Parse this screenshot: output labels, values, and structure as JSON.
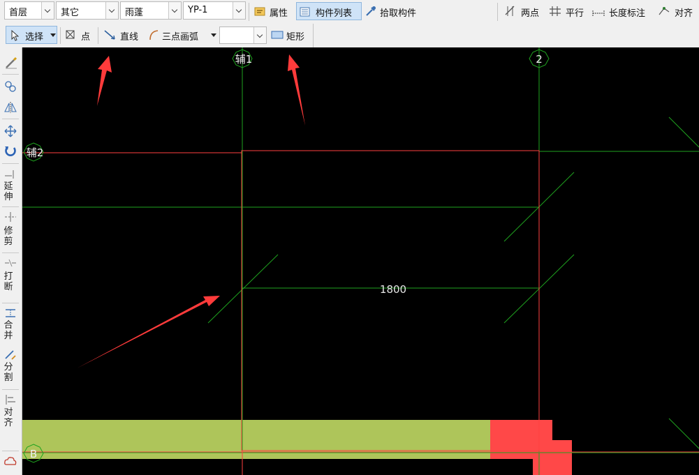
{
  "toolbar_top": {
    "floor_select": "首层",
    "type_select": "其它",
    "component_select": "雨蓬",
    "item_select": "YP-1",
    "properties_label": "属性",
    "component_list_label": "构件列表",
    "pick_component_label": "拾取构件",
    "two_points_label": "两点",
    "parallel_label": "平行",
    "length_dim_label": "长度标注",
    "align_label": "对齐"
  },
  "toolbar_draw": {
    "select_label": "选择",
    "point_label": "点",
    "line_label": "直线",
    "arc_label": "三点画弧",
    "rect_label": "矩形"
  },
  "left_toolbar": {
    "extend": [
      "延",
      "伸"
    ],
    "trim": [
      "修",
      "剪"
    ],
    "break": [
      "打",
      "断"
    ],
    "merge": [
      "合",
      "并"
    ],
    "split": [
      "分",
      "割"
    ],
    "align": [
      "对",
      "齐"
    ]
  },
  "cad": {
    "axis_aux1": "辅1",
    "axis_2": "2",
    "axis_aux2": "辅2",
    "axis_b": "B",
    "dimension": "1800"
  },
  "colors": {
    "canvas_bg": "#000000",
    "grid_line": "#1fa31f",
    "outline": "#ff4040",
    "slab": "#aec55a",
    "column": "#ff4848",
    "arrow": "#ff3b3b"
  }
}
